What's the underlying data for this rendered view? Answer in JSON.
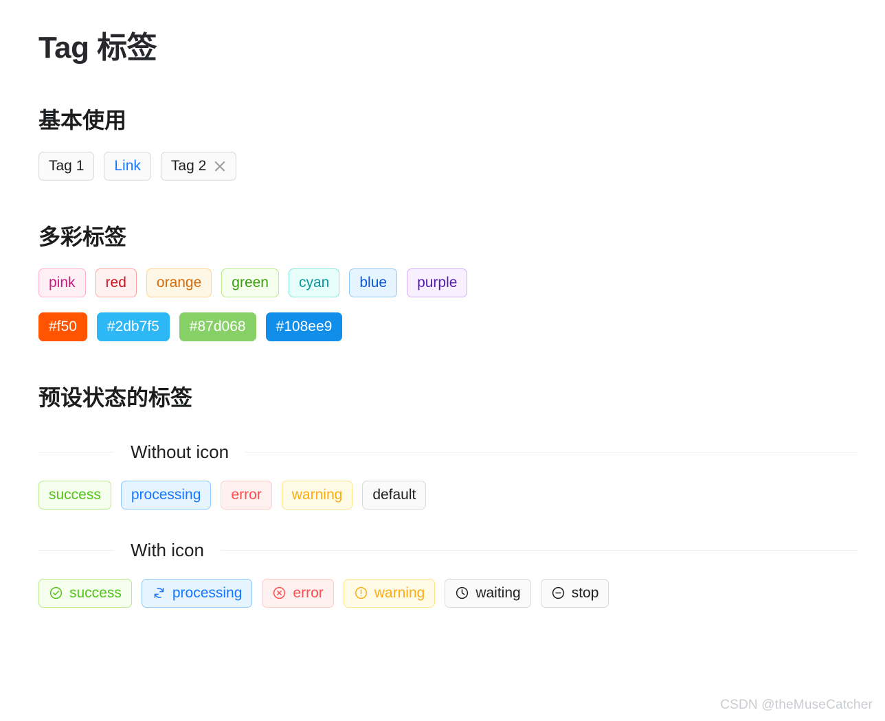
{
  "page": {
    "title": "Tag 标签",
    "watermark": "CSDN @theMuseCatcher"
  },
  "sections": [
    {
      "id": "basic",
      "title": "基本使用",
      "tags": [
        {
          "label": "Tag 1",
          "kind": "default",
          "closable": false
        },
        {
          "label": "Link",
          "kind": "link",
          "closable": false
        },
        {
          "label": "Tag 2",
          "kind": "default",
          "closable": true,
          "close_icon": "close-icon"
        }
      ]
    },
    {
      "id": "colorful",
      "title": "多彩标签",
      "preset_tags": [
        {
          "label": "pink",
          "bg": "#fff0f6",
          "border": "#ffadd2",
          "text": "#c41d7f"
        },
        {
          "label": "red",
          "bg": "#fff1f0",
          "border": "#ffa39e",
          "text": "#cf1322"
        },
        {
          "label": "orange",
          "bg": "#fff7e6",
          "border": "#ffd591",
          "text": "#d46b08"
        },
        {
          "label": "green",
          "bg": "#f6ffed",
          "border": "#b7eb8f",
          "text": "#389e0d"
        },
        {
          "label": "cyan",
          "bg": "#e6fffb",
          "border": "#87e8de",
          "text": "#08979c"
        },
        {
          "label": "blue",
          "bg": "#e6f4ff",
          "border": "#91caff",
          "text": "#0958d9"
        },
        {
          "label": "purple",
          "bg": "#f9f0ff",
          "border": "#d3adf7",
          "text": "#531dab"
        }
      ],
      "custom_tags": [
        {
          "label": "#f50",
          "bg": "#f50",
          "text": "#ffffff"
        },
        {
          "label": "#2db7f5",
          "bg": "#2db7f5",
          "text": "#ffffff"
        },
        {
          "label": "#87d068",
          "bg": "#87d068",
          "text": "#ffffff"
        },
        {
          "label": "#108ee9",
          "bg": "#108ee9",
          "text": "#ffffff"
        }
      ]
    },
    {
      "id": "status",
      "title": "预设状态的标签",
      "dividers": {
        "without_icon": "Without icon",
        "with_icon": "With icon"
      },
      "without_icon_tags": [
        {
          "label": "success",
          "bg": "#f6ffed",
          "border": "#b7eb8f",
          "text": "#52c41a"
        },
        {
          "label": "processing",
          "bg": "#e6f4ff",
          "border": "#91caff",
          "text": "#1677ff"
        },
        {
          "label": "error",
          "bg": "#fff1f0",
          "border": "#ffccc7",
          "text": "#ff4d4f"
        },
        {
          "label": "warning",
          "bg": "#fffbe6",
          "border": "#ffe58f",
          "text": "#faad14"
        },
        {
          "label": "default",
          "bg": "#fafafa",
          "border": "#d9d9d9",
          "text": "#1f1f1f"
        }
      ],
      "with_icon_tags": [
        {
          "label": "success",
          "icon": "check-circle-icon",
          "bg": "#f6ffed",
          "border": "#b7eb8f",
          "text": "#52c41a"
        },
        {
          "label": "processing",
          "icon": "sync-icon",
          "bg": "#e6f4ff",
          "border": "#91caff",
          "text": "#1677ff"
        },
        {
          "label": "error",
          "icon": "close-circle-icon",
          "bg": "#fff1f0",
          "border": "#ffccc7",
          "text": "#ff4d4f"
        },
        {
          "label": "warning",
          "icon": "exclamation-circle-icon",
          "bg": "#fffbe6",
          "border": "#ffe58f",
          "text": "#faad14"
        },
        {
          "label": "waiting",
          "icon": "clock-circle-icon",
          "bg": "#fafafa",
          "border": "#d9d9d9",
          "text": "#1f1f1f"
        },
        {
          "label": "stop",
          "icon": "minus-circle-icon",
          "bg": "#fafafa",
          "border": "#d9d9d9",
          "text": "#1f1f1f"
        }
      ]
    }
  ]
}
